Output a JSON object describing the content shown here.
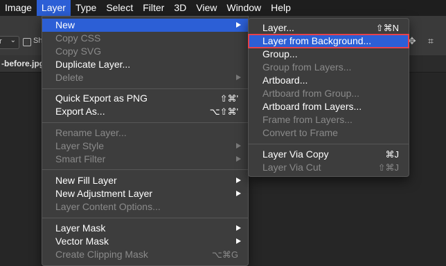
{
  "menubar": {
    "items": [
      {
        "label": "Image",
        "active": false
      },
      {
        "label": "Layer",
        "active": true
      },
      {
        "label": "Type",
        "active": false
      },
      {
        "label": "Select",
        "active": false
      },
      {
        "label": "Filter",
        "active": false
      },
      {
        "label": "3D",
        "active": false
      },
      {
        "label": "View",
        "active": false
      },
      {
        "label": "Window",
        "active": false
      },
      {
        "label": "Help",
        "active": false
      }
    ]
  },
  "options_bar": {
    "dropdown_value": "r",
    "checkbox_label": "Sh"
  },
  "document_tab": {
    "label": "-before.jpg"
  },
  "layer_menu": {
    "items": [
      {
        "label": "New",
        "shortcut": "",
        "submenu": true,
        "disabled": false,
        "highlight": true
      },
      {
        "label": "Copy CSS",
        "shortcut": "",
        "submenu": false,
        "disabled": true
      },
      {
        "label": "Copy SVG",
        "shortcut": "",
        "submenu": false,
        "disabled": true
      },
      {
        "label": "Duplicate Layer...",
        "shortcut": "",
        "submenu": false,
        "disabled": false
      },
      {
        "label": "Delete",
        "shortcut": "",
        "submenu": true,
        "disabled": true
      },
      {
        "label": "Quick Export as PNG",
        "shortcut": "⇧⌘'",
        "submenu": false,
        "disabled": false
      },
      {
        "label": "Export As...",
        "shortcut": "⌥⇧⌘'",
        "submenu": false,
        "disabled": false
      },
      {
        "label": "Rename Layer...",
        "shortcut": "",
        "submenu": false,
        "disabled": true
      },
      {
        "label": "Layer Style",
        "shortcut": "",
        "submenu": true,
        "disabled": true
      },
      {
        "label": "Smart Filter",
        "shortcut": "",
        "submenu": true,
        "disabled": true
      },
      {
        "label": "New Fill Layer",
        "shortcut": "",
        "submenu": true,
        "disabled": false
      },
      {
        "label": "New Adjustment Layer",
        "shortcut": "",
        "submenu": true,
        "disabled": false
      },
      {
        "label": "Layer Content Options...",
        "shortcut": "",
        "submenu": false,
        "disabled": true
      },
      {
        "label": "Layer Mask",
        "shortcut": "",
        "submenu": true,
        "disabled": false
      },
      {
        "label": "Vector Mask",
        "shortcut": "",
        "submenu": true,
        "disabled": false
      },
      {
        "label": "Create Clipping Mask",
        "shortcut": "⌥⌘G",
        "submenu": false,
        "disabled": true
      }
    ]
  },
  "new_submenu": {
    "items": [
      {
        "label": "Layer...",
        "shortcut": "⇧⌘N",
        "disabled": false
      },
      {
        "label": "Layer from Background...",
        "shortcut": "",
        "disabled": false,
        "highlight": true
      },
      {
        "label": "Group...",
        "shortcut": "",
        "disabled": false
      },
      {
        "label": "Group from Layers...",
        "shortcut": "",
        "disabled": true
      },
      {
        "label": "Artboard...",
        "shortcut": "",
        "disabled": false
      },
      {
        "label": "Artboard from Group...",
        "shortcut": "",
        "disabled": true
      },
      {
        "label": "Artboard from Layers...",
        "shortcut": "",
        "disabled": false
      },
      {
        "label": "Frame from Layers...",
        "shortcut": "",
        "disabled": true
      },
      {
        "label": "Convert to Frame",
        "shortcut": "",
        "disabled": true
      },
      {
        "label": "Layer Via Copy",
        "shortcut": "⌘J",
        "disabled": false
      },
      {
        "label": "Layer Via Cut",
        "shortcut": "⇧⌘J",
        "disabled": true
      }
    ]
  },
  "colors": {
    "accent": "#2c5fd6",
    "annotation_outline": "#e8424a",
    "menu_bg": "#3d3d3d",
    "menubar_bg": "#1e1e1e"
  }
}
